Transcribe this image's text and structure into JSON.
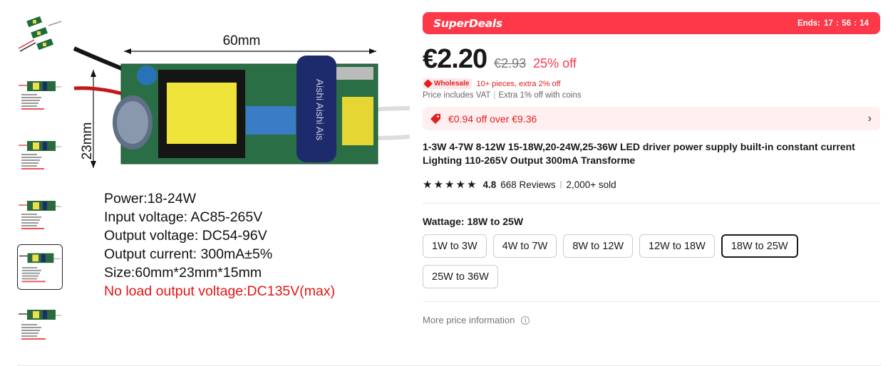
{
  "gallery": {
    "thumbnails": [
      "thumb-1",
      "thumb-2",
      "thumb-3",
      "thumb-4",
      "thumb-5",
      "thumb-6"
    ],
    "selected_index": 4,
    "main_image": {
      "dimension_width": "60mm",
      "dimension_height": "23mm",
      "specs": [
        "Power:18-24W",
        "Input voltage: AC85-265V",
        "Output voltage: DC54-96V",
        "Output current: 300mA±5%",
        "Size:60mm*23mm*15mm",
        "No load output voltage:DC135V(max)"
      ]
    }
  },
  "deal": {
    "brand": "SuperDeals",
    "ends_label": "Ends:",
    "ends_h": "17",
    "ends_m": "56",
    "ends_s": "14",
    "color": "#fd3848"
  },
  "price": {
    "current": "€2.20",
    "original": "€2.93",
    "discount": "25% off"
  },
  "wholesale": {
    "badge": "Wholesale",
    "text": "10+ pieces, extra 2% off"
  },
  "vat": {
    "text": "Price includes VAT",
    "coins": "Extra 1% off with coins"
  },
  "coupon": {
    "icon": "tag-icon",
    "text": "€0.94 off over €9.36",
    "chevron": "›"
  },
  "product": {
    "title": "1-3W 4-7W 8-12W 15-18W,20-24W,25-36W LED driver power supply built-in constant current Lighting 110-265V Output 300mA Transforme",
    "rating": 4.8,
    "rating_text": "4.8",
    "reviews": "668 Reviews",
    "sold": "2,000+ sold"
  },
  "wattage": {
    "label": "Wattage: 18W to 25W",
    "options": [
      "1W to 3W",
      "4W to 7W",
      "8W to 12W",
      "12W to 18W",
      "18W to 25W",
      "25W to 36W"
    ],
    "selected": "18W to 25W"
  },
  "more_info": {
    "label": "More price information",
    "icon": "info-icon"
  }
}
